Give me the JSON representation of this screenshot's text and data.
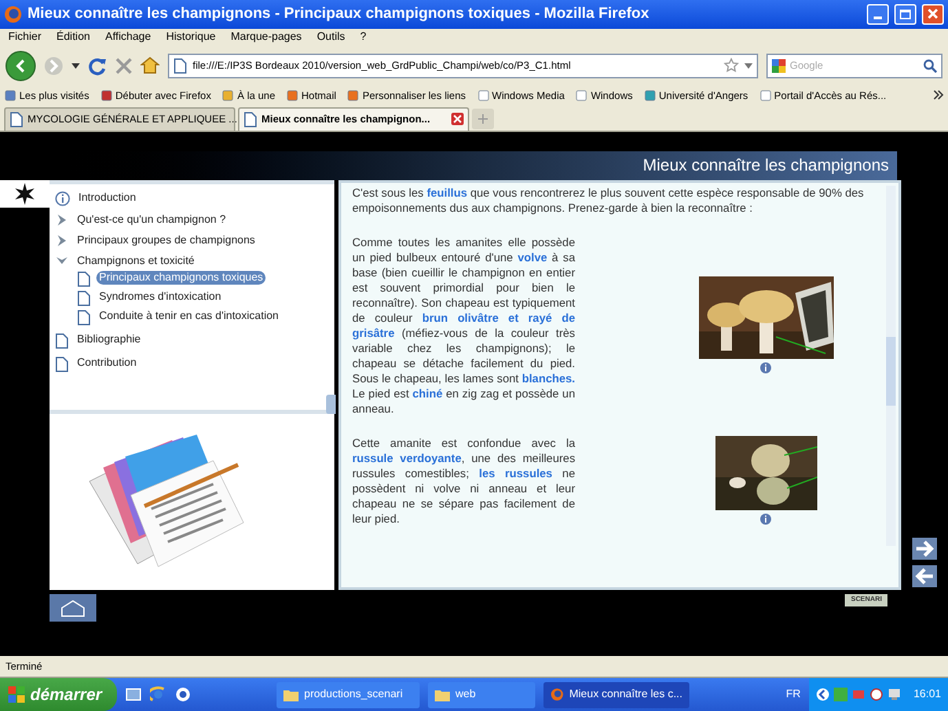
{
  "window": {
    "title": "Mieux connaître les champignons - Principaux champignons toxiques - Mozilla Firefox"
  },
  "menu": [
    "Fichier",
    "Édition",
    "Affichage",
    "Historique",
    "Marque-pages",
    "Outils",
    "?"
  ],
  "navbar": {
    "url": "file:///E:/IP3S Bordeaux 2010/version_web_GrdPublic_Champi/web/co/P3_C1.html",
    "search": {
      "placeholder": "Google"
    }
  },
  "bookmarks": [
    "Les plus visités",
    "Débuter avec Firefox",
    "À la une",
    "Hotmail",
    "Personnaliser les liens",
    "Windows Media",
    "Windows",
    "Université d'Angers",
    "Portail d'Accès au Rés..."
  ],
  "tabs": [
    {
      "label": "MYCOLOGIE GÉNÉRALE ET APPLIQUEE ...",
      "selected": false
    },
    {
      "label": "Mieux connaître les champignon...",
      "selected": true
    }
  ],
  "page": {
    "header": "Mieux connaître les champignons",
    "toc": [
      {
        "kind": "info",
        "label": "Introduction",
        "selected": false
      },
      {
        "kind": "section",
        "label": "Qu'est-ce qu'un champignon ?",
        "expanded": false,
        "selected": false
      },
      {
        "kind": "section",
        "label": "Principaux groupes de champignons",
        "expanded": false,
        "selected": false
      },
      {
        "kind": "section",
        "label": "Champignons et toxicité",
        "expanded": true,
        "selected": false,
        "children": [
          {
            "kind": "page",
            "label": "Principaux champignons toxiques",
            "selected": true
          },
          {
            "kind": "page",
            "label": "Syndromes d'intoxication",
            "selected": false
          },
          {
            "kind": "page",
            "label": "Conduite à tenir en cas d'intoxication",
            "selected": false
          }
        ]
      },
      {
        "kind": "page",
        "label": "Bibliographie",
        "selected": false
      },
      {
        "kind": "page",
        "label": "Contribution",
        "selected": false
      }
    ],
    "intro": "C'est sous les **feuillus** que vous rencontrerez le plus souvent cette espèce responsable de 90% des empoisonnements dus aux champignons. Prenez-garde à bien la reconnaître :",
    "blocks": [
      {
        "text": "Comme toutes les amanites elle possède un pied bulbeux entouré d'une **volve** à sa base (bien cueillir le champignon en entier est souvent primordial pour bien le reconnaître). Son chapeau est typiquement de couleur **brun olivâtre et rayé de grisâtre** (méfiez-vous de la couleur très variable chez les champignons); le chapeau se détache facilement du pied. Sous le chapeau, les lames sont **blanches.** Le pied est **chiné** en zig zag et possède un anneau."
      },
      {
        "text": "Cette amanite est confondue avec la **russule verdoyante**, une des meilleures russules comestibles; **les russules** ne possèdent ni volve ni anneau et leur chapeau ne se sépare pas facilement de leur pied."
      }
    ],
    "badge": "SCENARI"
  },
  "status_bar": "Terminé",
  "taskbar": {
    "start": "démarrer",
    "tasks": [
      {
        "label": "productions_scenari",
        "kind": "folder",
        "selected": false
      },
      {
        "label": "web",
        "kind": "folder",
        "selected": false
      },
      {
        "label": "Mieux connaître les c...",
        "kind": "browser",
        "selected": true
      }
    ],
    "language": "FR",
    "clock": "16:01"
  }
}
